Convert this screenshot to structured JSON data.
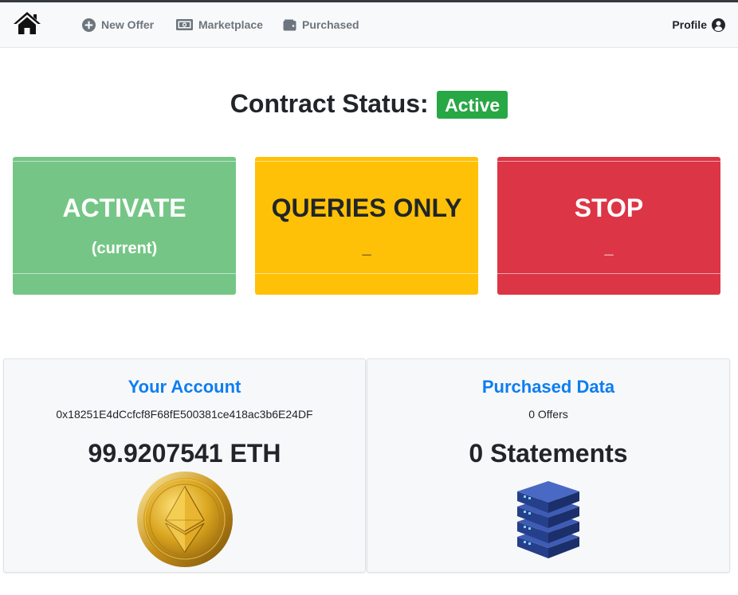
{
  "navbar": {
    "home_icon": "home-icon",
    "items": [
      {
        "label": "New Offer",
        "icon": "plus-circle-icon"
      },
      {
        "label": "Marketplace",
        "icon": "money-bill-icon"
      },
      {
        "label": "Purchased",
        "icon": "wallet-icon"
      }
    ],
    "profile": {
      "label": "Profile",
      "icon": "user-circle-icon"
    }
  },
  "contract": {
    "title": "Contract Status:",
    "status": "Active",
    "status_color": "#28a745"
  },
  "modes": [
    {
      "title": "ACTIVATE",
      "subtitle": "(current)",
      "color": "#75c686"
    },
    {
      "title": "QUERIES ONLY",
      "subtitle": "_",
      "color": "#ffc107"
    },
    {
      "title": "STOP",
      "subtitle": "_",
      "color": "#dc3545"
    }
  ],
  "account": {
    "title": "Your Account",
    "address": "0x18251E4dCcfcf8F68fE500381ce418ac3b6E24DF",
    "balance": "99.9207541 ETH",
    "icon": "ethereum-coin-icon"
  },
  "purchased": {
    "title": "Purchased Data",
    "offers": "0 Offers",
    "statements": "0 Statements",
    "icon": "server-stack-icon"
  },
  "colors": {
    "accent_blue": "#0d7ef0",
    "navbar_bg": "#f8f9fa",
    "muted_text": "#6c757d"
  }
}
